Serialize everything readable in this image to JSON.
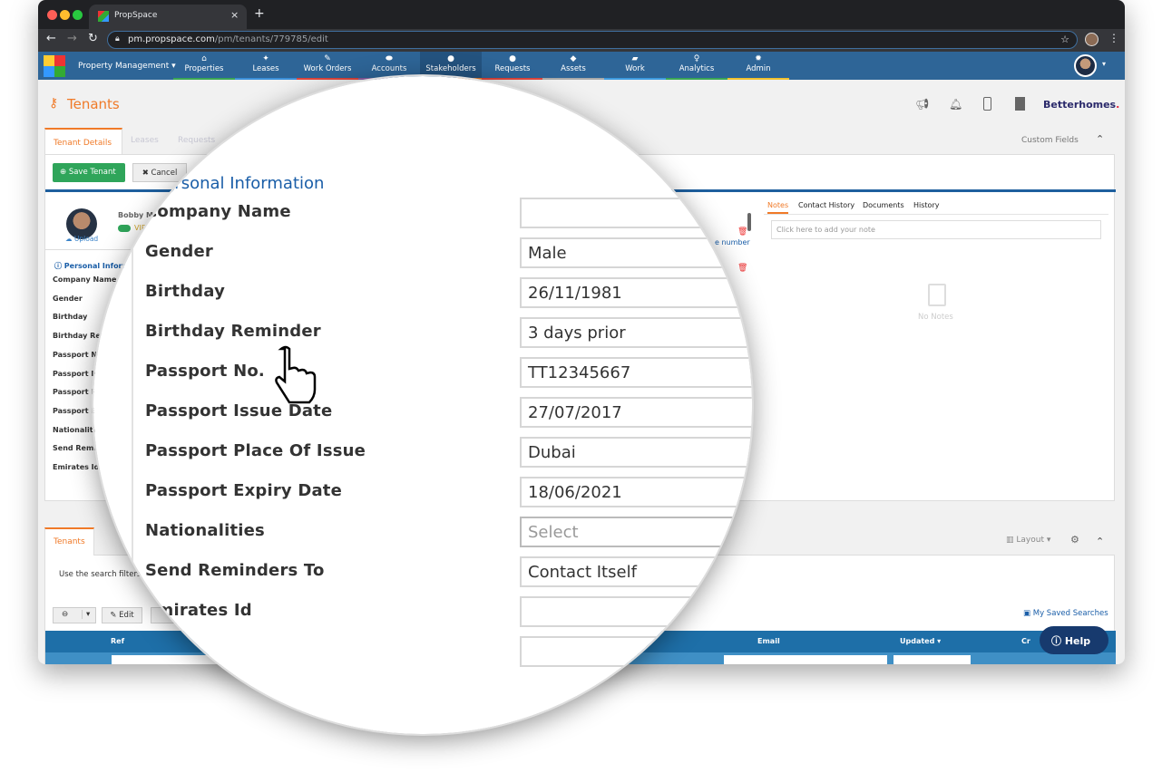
{
  "browser": {
    "tab_title": "PropSpace",
    "tab_close": "×",
    "new_tab": "+",
    "url_host": "pm.propspace.com",
    "url_path": "/pm/tenants/779785/edit"
  },
  "nav": {
    "module": "Property Management ▾",
    "items": [
      {
        "label": "Properties",
        "icon": "home-icon",
        "glyph": "⌂",
        "color": "#3aa655"
      },
      {
        "label": "Leases",
        "icon": "handshake-icon",
        "glyph": "✦",
        "color": "#3b8fd9"
      },
      {
        "label": "Work Orders",
        "icon": "clipboard-icon",
        "glyph": "✎",
        "color": "#e0463c"
      },
      {
        "label": "Accounts",
        "icon": "money-icon",
        "glyph": "⬬",
        "color": "#8e5ea2"
      },
      {
        "label": "Stakeholders",
        "icon": "user-icon",
        "glyph": "●",
        "color": "#e87c2a"
      },
      {
        "label": "Requests",
        "icon": "comment-icon",
        "glyph": "●",
        "color": "#e0463c"
      },
      {
        "label": "Assets",
        "icon": "tag-icon",
        "glyph": "◆",
        "color": "#aaaaaa"
      },
      {
        "label": "Work",
        "icon": "briefcase-icon",
        "glyph": "▰",
        "color": "#3d9be0"
      },
      {
        "label": "Analytics",
        "icon": "lightbulb-icon",
        "glyph": "♀",
        "color": "#3aa655"
      },
      {
        "label": "Admin",
        "icon": "gear-icon",
        "glyph": "✹",
        "color": "#f2c12e"
      }
    ],
    "active": "Stakeholders"
  },
  "page": {
    "title": "Tenants",
    "brand": "Betterhomes",
    "brand_dot": ".",
    "custom_fields": "Custom Fields"
  },
  "tabs": [
    "Tenant Details",
    "Leases",
    "Requests"
  ],
  "actions": {
    "save": "Save Tenant",
    "cancel": "Cancel"
  },
  "profile": {
    "name": "Bobby M",
    "vip": "VIP",
    "upload": "Upload",
    "section": "Personal Informa",
    "phone_link": "e number"
  },
  "fields": [
    {
      "label": "Company Name",
      "short": "Company Name",
      "value": ""
    },
    {
      "label": "Gender",
      "short": "Gender",
      "value": "Male"
    },
    {
      "label": "Birthday",
      "short": "Birthday",
      "value": "26/11/1981"
    },
    {
      "label": "Birthday Reminder",
      "short": "Birthday Rem",
      "value": "3 days prior"
    },
    {
      "label": "Passport No.",
      "short": "Passport No",
      "value": "TT12345667"
    },
    {
      "label": "Passport Issue Date",
      "short": "Passport Is",
      "value": "27/07/2017"
    },
    {
      "label": "Passport Place Of Issue",
      "short": "Passport Pl",
      "value": "Dubai"
    },
    {
      "label": "Passport Expiry Date",
      "short": "Passport E",
      "value": "18/06/2021"
    },
    {
      "label": "Nationalities",
      "short": "Nationaliti",
      "value": "",
      "placeholder": "Select"
    },
    {
      "label": "Send Reminders To",
      "short": "Send Remi",
      "value": "Contact Itself"
    },
    {
      "label": "Emirates Id",
      "short": "Emirates Id",
      "value": ""
    }
  ],
  "magnified_heading": "Personal Information",
  "notes": {
    "tabs": [
      "Notes",
      "Contact History",
      "Documents",
      "History"
    ],
    "placeholder": "Click here to add your note",
    "empty": "No Notes"
  },
  "list": {
    "tab": "Tenants",
    "hint": "Use the search filters",
    "layout": "Layout ▾",
    "edit": "Edit",
    "saved_searches": "My Saved Searches",
    "columns": [
      "Ref",
      "Email",
      "Updated ▾",
      "Cr"
    ]
  },
  "help": "Help",
  "colors": {
    "accent": "#f07a28",
    "nav": "#2e6597",
    "save": "#2fa55a",
    "link": "#1a5ea8",
    "table_header": "#1e6fa8",
    "help": "#173a6e"
  }
}
